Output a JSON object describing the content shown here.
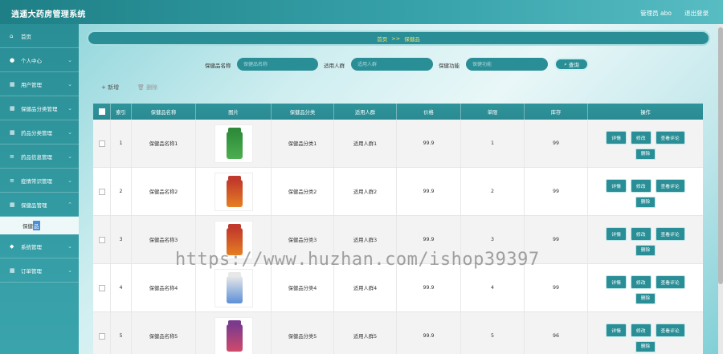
{
  "app": {
    "title": "逍遥大药房管理系统",
    "admin": "管理员 abo",
    "logout": "退出登录"
  },
  "sidebar": {
    "items": [
      {
        "label": "首页",
        "icon": "home-icon",
        "glyph": "⌂"
      },
      {
        "label": "个人中心",
        "icon": "user-icon",
        "glyph": "●"
      },
      {
        "label": "用户管理",
        "icon": "grid-icon",
        "glyph": "▦"
      },
      {
        "label": "保健品分类管理",
        "icon": "grid-icon",
        "glyph": "▦"
      },
      {
        "label": "药品分类管理",
        "icon": "grid-icon",
        "glyph": "▦"
      },
      {
        "label": "药品信息管理",
        "icon": "sliders-icon",
        "glyph": "≡"
      },
      {
        "label": "疫情常识管理",
        "icon": "list-icon",
        "glyph": "≡"
      },
      {
        "label": "保健品管理",
        "icon": "grid-icon",
        "glyph": "▦"
      },
      {
        "label": "系统管理",
        "icon": "shield-icon",
        "glyph": "◆"
      },
      {
        "label": "订单管理",
        "icon": "grid-icon",
        "glyph": "▦"
      }
    ],
    "sub_item": {
      "prefix": "保健",
      "highlight": "品"
    }
  },
  "breadcrumb": {
    "home": "首页",
    "sep": ">>",
    "current": "保健品"
  },
  "search": {
    "name_label": "保健品名称",
    "name_placeholder": "保健品名称",
    "crowd_label": "适用人群",
    "crowd_placeholder": "适用人群",
    "func_label": "保健功能",
    "func_placeholder": "保健功能",
    "button": "查询"
  },
  "actions": {
    "add": "新增",
    "delete": "删除"
  },
  "table": {
    "headers": [
      "索引",
      "保健品名称",
      "图片",
      "保健品分类",
      "适用人群",
      "价格",
      "单限",
      "库存",
      "操作"
    ],
    "buttons": {
      "detail": "详情",
      "edit": "修改",
      "review": "查看评论",
      "delete": "删除"
    },
    "rows": [
      {
        "index": "1",
        "name": "保健品名称1",
        "category": "保健品分类1",
        "crowd": "适用人群1",
        "price": "99.9",
        "limit": "1",
        "stock": "99"
      },
      {
        "index": "2",
        "name": "保健品名称2",
        "category": "保健品分类2",
        "crowd": "适用人群2",
        "price": "99.9",
        "limit": "2",
        "stock": "99"
      },
      {
        "index": "3",
        "name": "保健品名称3",
        "category": "保健品分类3",
        "crowd": "适用人群3",
        "price": "99.9",
        "limit": "3",
        "stock": "99"
      },
      {
        "index": "4",
        "name": "保健品名称4",
        "category": "保健品分类4",
        "crowd": "适用人群4",
        "price": "99.9",
        "limit": "4",
        "stock": "99"
      },
      {
        "index": "5",
        "name": "保健品名称5",
        "category": "保健品分类5",
        "crowd": "适用人群5",
        "price": "99.9",
        "limit": "5",
        "stock": "96"
      }
    ]
  },
  "watermark": "https://www.huzhan.com/ishop39397",
  "colors": {
    "accent": "#2a8e96",
    "breadcrumb_text": "#f5e26b"
  }
}
